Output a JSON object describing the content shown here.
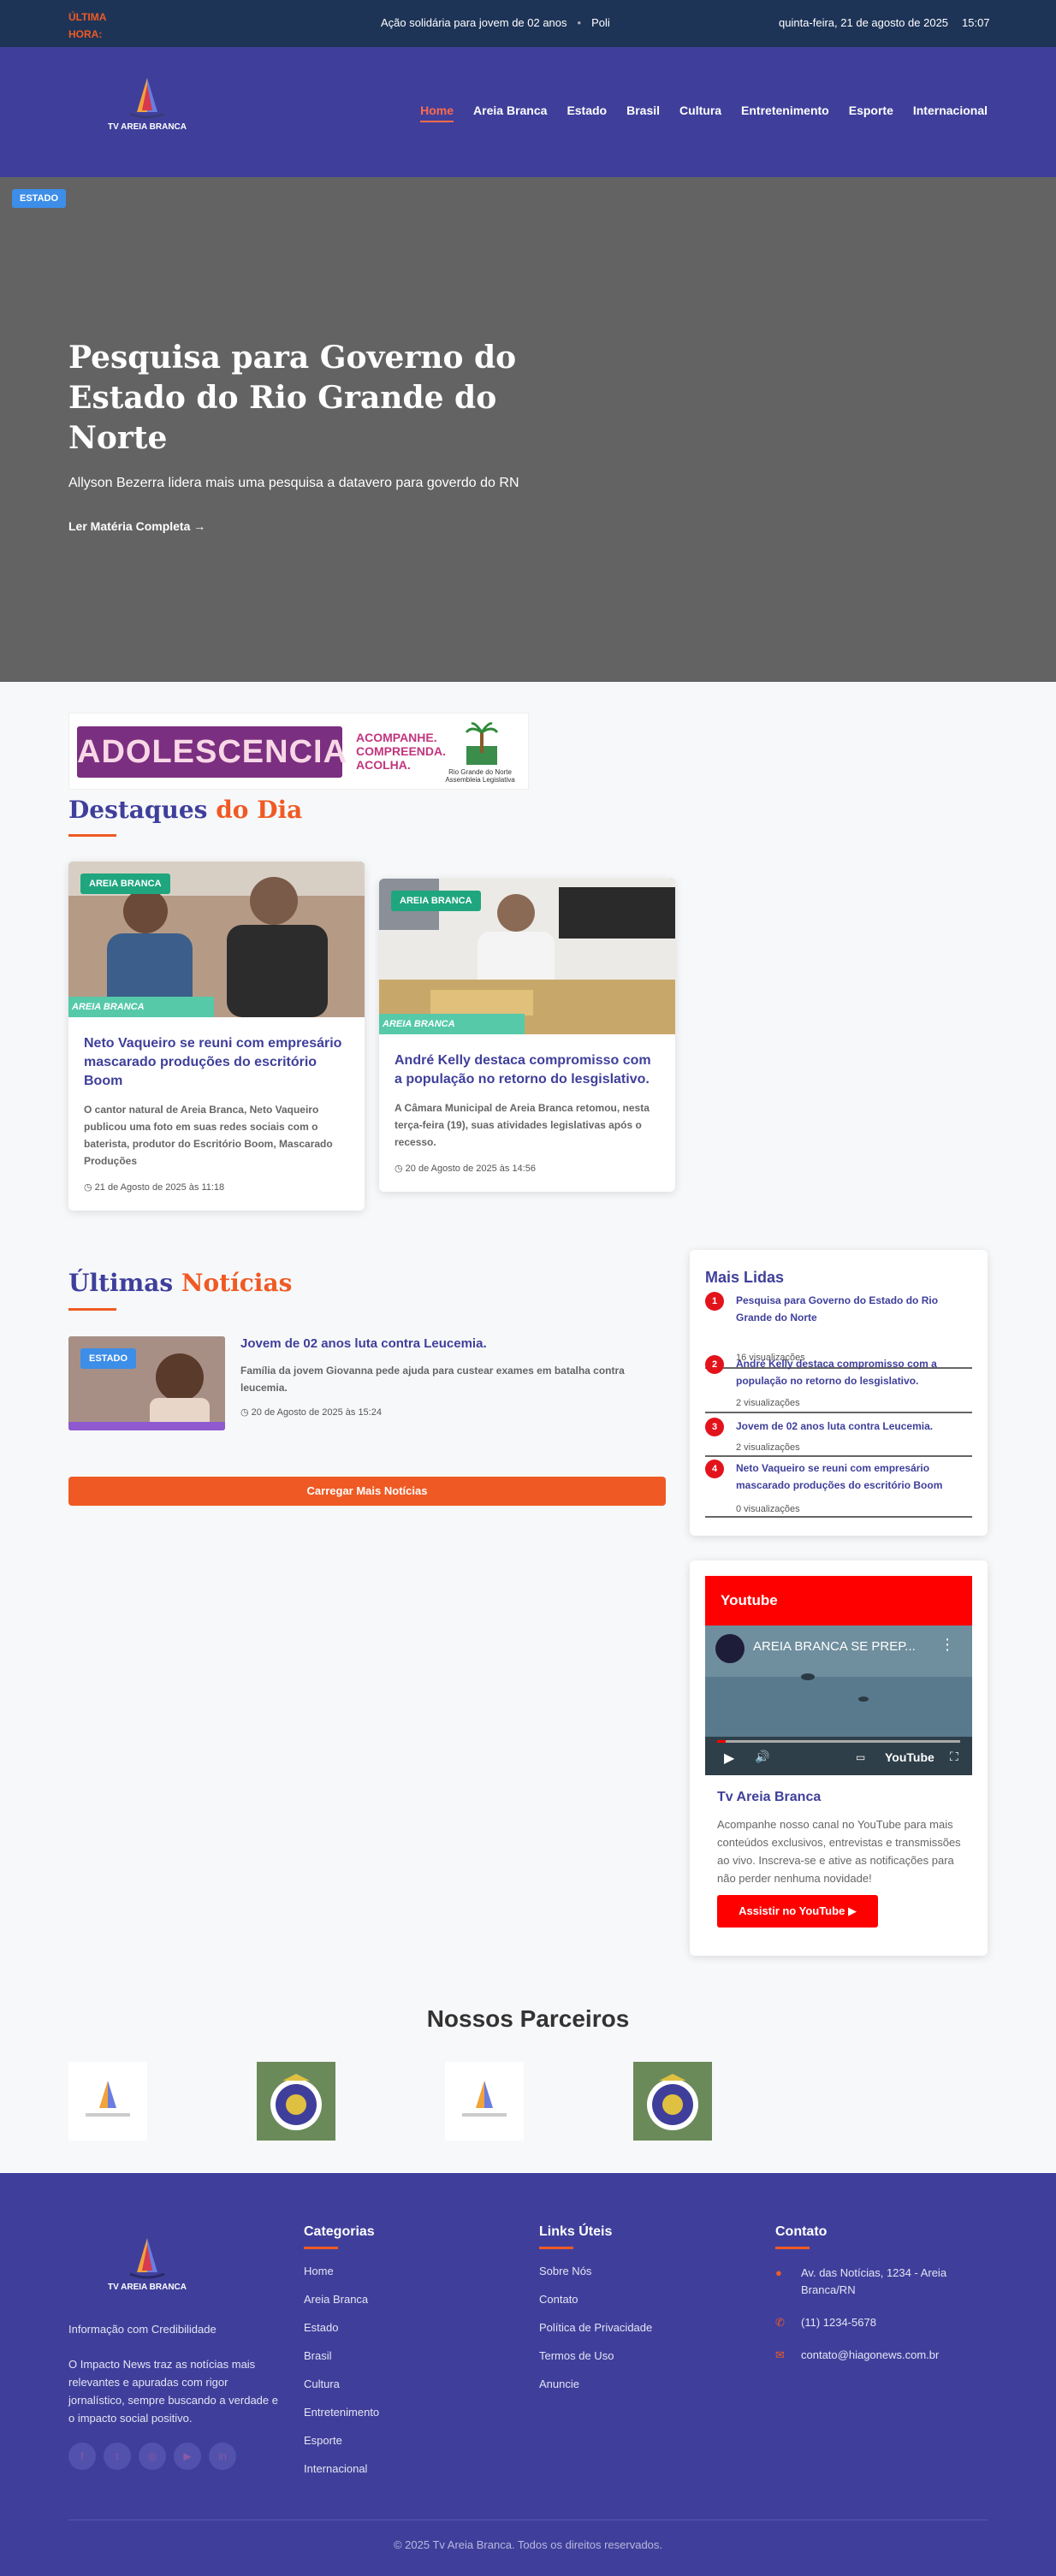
{
  "topbar": {
    "label": "ÚLTIMA HORA:",
    "ticker": [
      "Ação solidária para jovem de 02 anos",
      "Poli"
    ],
    "date": "quinta-feira, 21 de agosto de 2025",
    "time": "15:07"
  },
  "header": {
    "logo_text": "TV AREIA BRANCA",
    "nav": [
      "Home",
      "Areia Branca",
      "Estado",
      "Brasil",
      "Cultura",
      "Entretenimento",
      "Esporte",
      "Internacional"
    ]
  },
  "hero": {
    "badge": "ESTADO",
    "title": "Pesquisa para Governo do Estado do Rio Grande do Norte",
    "subtitle": "Allyson Bezerra lidera mais uma pesquisa a datavero para goverdo do RN",
    "link": "Ler Matéria Completa →"
  },
  "banner": {
    "word": "ADOLESCENCIA",
    "tag": [
      "ACOMPANHE.",
      "COMPREENDA.",
      "ACOLHA."
    ],
    "org": "Rio Grande do Norte Assembleia Legislativa"
  },
  "destaques": {
    "title_a": "Destaques",
    "title_b": "do Dia",
    "cards": [
      {
        "category": "AREIA BRANCA",
        "strip": "AREIA BRANCA",
        "title": "Neto Vaqueiro se reuni com empresário mascarado produções do escritório Boom",
        "text": "O cantor natural de Areia Branca, Neto Vaqueiro publicou uma foto em suas redes sociais com o baterista, produtor do Escritório Boom, Mascarado Produções",
        "date": "21 de Agosto de 2025 às 11:18"
      },
      {
        "category": "AREIA BRANCA",
        "strip": "AREIA BRANCA",
        "title": "André Kelly destaca compromisso com a população no retorno do lesgislativo.",
        "text": "A Câmara Municipal de Areia Branca retomou, nesta terça-feira (19), suas atividades legislativas após o recesso.",
        "date": "20 de Agosto de 2025 às 14:56"
      }
    ]
  },
  "ultimas": {
    "title_a": "Últimas",
    "title_b": "Notícias",
    "items": [
      {
        "category": "ESTADO",
        "title": "Jovem de 02 anos luta contra Leucemia.",
        "text": "Família da jovem Giovanna pede ajuda para custear exames em batalha contra leucemia.",
        "date": "20 de Agosto de 2025 às 15:24"
      }
    ],
    "load_more": "Carregar Mais Notícias"
  },
  "mais_lidas": {
    "title": "Mais Lidas",
    "items": [
      {
        "num": "1",
        "title": "Pesquisa para Governo do Estado do Rio Grande do Norte",
        "views": "16 visualizações"
      },
      {
        "num": "2",
        "title": "André Kelly destaca compromisso com a população no retorno do lesgislativo.",
        "views": "2 visualizações"
      },
      {
        "num": "3",
        "title": "Jovem de 02 anos luta contra Leucemia.",
        "views": "2 visualizações"
      },
      {
        "num": "4",
        "title": "Neto Vaqueiro se reuni com empresário mascarado produções do escritório Boom",
        "views": "0 visualizações"
      }
    ]
  },
  "youtube": {
    "header": "Youtube",
    "video_title": "AREIA BRANCA SE PREP...",
    "brand": "YouTube",
    "channel": "Tv Areia Branca",
    "text": "Acompanhe nosso canal no YouTube para mais conteúdos exclusivos, entrevistas e transmissões ao vivo. Inscreva-se e ative as notificações para não perder nenhuma novidade!",
    "button": "Assistir no YouTube"
  },
  "partners": {
    "title": "Nossos Parceiros"
  },
  "footer": {
    "tagline": "Informação com Credibilidade",
    "about": "O Impacto News traz as notícias mais relevantes e apuradas com rigor jornalístico, sempre buscando a verdade e o impacto social positivo.",
    "categorias": {
      "title": "Categorias",
      "links": [
        "Home",
        "Areia Branca",
        "Estado",
        "Brasil",
        "Cultura",
        "Entretenimento",
        "Esporte",
        "Internacional"
      ]
    },
    "links_uteis": {
      "title": "Links Úteis",
      "links": [
        "Sobre Nós",
        "Contato",
        "Política de Privacidade",
        "Termos de Uso",
        "Anuncie"
      ]
    },
    "contato": {
      "title": "Contato",
      "address": "Av. das Notícias, 1234 - Areia Branca/RN",
      "phone": "(11) 1234-5678",
      "email": "contato@hiagonews.com.br"
    },
    "copyright": "© 2025 Tv Areia Branca. Todos os direitos reservados."
  },
  "colors": {
    "brand": "#3f3f9b",
    "accent": "#ef5a24",
    "topbar": "#1e3457",
    "youtube": "#ff0000"
  }
}
